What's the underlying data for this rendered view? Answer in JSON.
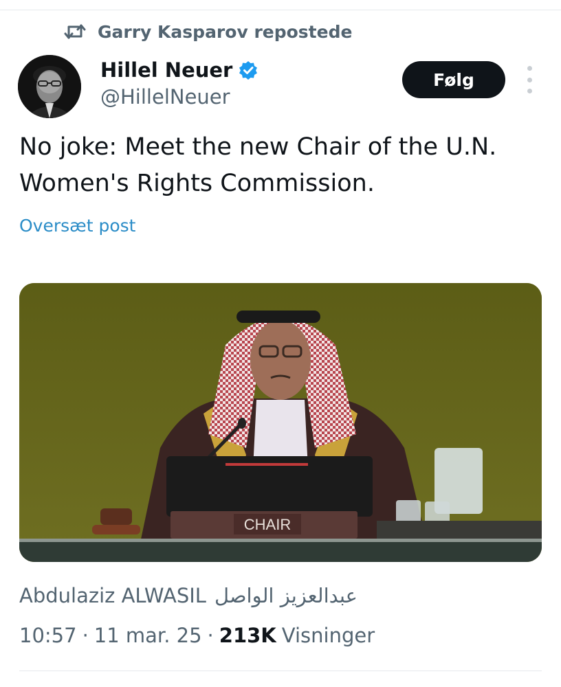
{
  "repost": {
    "icon": "repost-icon",
    "label": "Garry Kasparov repostede"
  },
  "author": {
    "display_name": "Hillel Neuer",
    "handle": "@HillelNeuer",
    "verified": true,
    "verified_color": "#1d9bf0"
  },
  "follow_label": "Følg",
  "post": {
    "text_line1": "No joke: Meet the new Chair of the U.N.",
    "text_line2": "Women's Rights Commission.",
    "translate_label": "Oversæt post"
  },
  "media": {
    "nameplate": "CHAIR"
  },
  "caption": {
    "latin": "Abdulaziz ALWASIL",
    "arabic": "عبدالعزيز الواصل"
  },
  "meta": {
    "time": "10:57",
    "sep1": "·",
    "date": "11 mar. 25",
    "sep2": "·",
    "views_count": "213K",
    "views_label": "Visninger"
  },
  "colors": {
    "text_primary": "#0f1419",
    "text_secondary": "#536471",
    "link": "#2a8cc7",
    "button_bg": "#0f1419"
  }
}
